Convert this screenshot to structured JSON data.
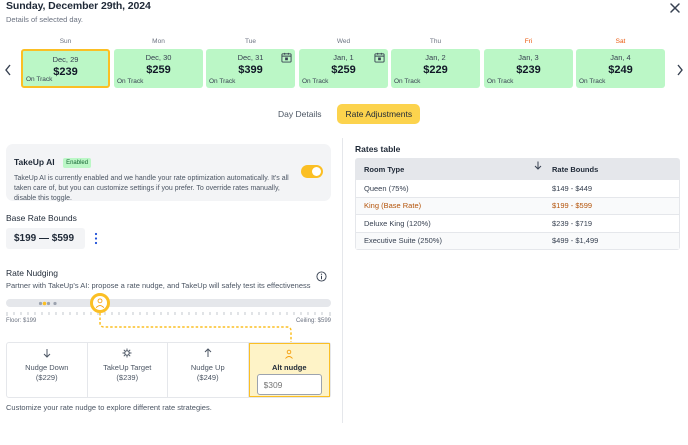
{
  "header": {
    "title": "Sunday, December 29th, 2024",
    "subtitle": "Details of selected day."
  },
  "days": [
    {
      "weekday": "Sun",
      "date": "Dec, 29",
      "price": "$239",
      "status": "On Track",
      "weekend": false,
      "selected": true,
      "calendar_icon": false
    },
    {
      "weekday": "Mon",
      "date": "Dec, 30",
      "price": "$259",
      "status": "On Track",
      "weekend": false,
      "selected": false,
      "calendar_icon": false
    },
    {
      "weekday": "Tue",
      "date": "Dec, 31",
      "price": "$399",
      "status": "On Track",
      "weekend": false,
      "selected": false,
      "calendar_icon": true
    },
    {
      "weekday": "Wed",
      "date": "Jan, 1",
      "price": "$259",
      "status": "On Track",
      "weekend": false,
      "selected": false,
      "calendar_icon": true
    },
    {
      "weekday": "Thu",
      "date": "Jan, 2",
      "price": "$229",
      "status": "On Track",
      "weekend": false,
      "selected": false,
      "calendar_icon": false
    },
    {
      "weekday": "Fri",
      "date": "Jan, 3",
      "price": "$239",
      "status": "On Track",
      "weekend": true,
      "selected": false,
      "calendar_icon": false
    },
    {
      "weekday": "Sat",
      "date": "Jan, 4",
      "price": "$249",
      "status": "On Track",
      "weekend": true,
      "selected": false,
      "calendar_icon": false
    }
  ],
  "tabs": {
    "day_details": "Day Details",
    "rate_adjustments": "Rate Adjustments",
    "active": "rate_adjustments"
  },
  "takeup_ai": {
    "title": "TakeUp AI",
    "badge": "Enabled",
    "description": "TakeUp AI is currently enabled and we handle your rate optimization automatically. It's all taken care of, but you can customize settings if you prefer. To override rates manually, disable this toggle.",
    "toggle_on": true
  },
  "base_rate": {
    "label": "Base Rate Bounds",
    "value": "$199 — $599"
  },
  "nudging": {
    "label": "Rate Nudging",
    "subtitle": "Partner with TakeUp's AI: propose a rate nudge, and TakeUp will safely test its effectiveness",
    "floor": "Floor: $199",
    "ceiling": "Ceiling: $599",
    "options": [
      {
        "label": "Nudge Down",
        "value": "($229)",
        "icon": "arrow-down-icon"
      },
      {
        "label": "TakeUp Target",
        "value": "($239)",
        "icon": "target-icon"
      },
      {
        "label": "Nudge Up",
        "value": "($249)",
        "icon": "arrow-up-icon"
      },
      {
        "label": "Alt nudge",
        "icon": "person-icon",
        "input_placeholder": "$309"
      }
    ],
    "note": "Customize your rate nudge to explore different rate strategies."
  },
  "rates_table": {
    "title": "Rates table",
    "columns": [
      "Room Type",
      "Rate Bounds"
    ],
    "rows": [
      {
        "room": "Queen (75%)",
        "bounds": "$149 - $449",
        "base": false
      },
      {
        "room": "King (Base Rate)",
        "bounds": "$199 - $599",
        "base": true
      },
      {
        "room": "Deluxe King (120%)",
        "bounds": "$239 - $719",
        "base": false
      },
      {
        "room": "Executive Suite (250%)",
        "bounds": "$499 - $1,499",
        "base": false
      }
    ]
  },
  "colors": {
    "accent": "#fbbf24",
    "on_track": "#bbf7c6",
    "weekend": "#ea580c",
    "base_rate_row": "#b45309"
  }
}
